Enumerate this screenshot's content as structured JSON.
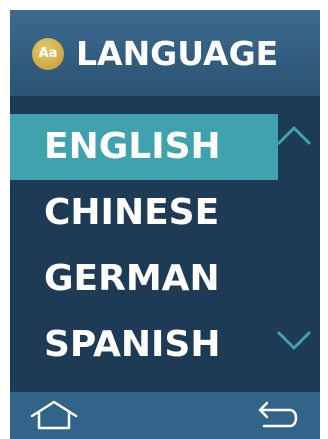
{
  "header": {
    "icon_text": "Aa",
    "title": "LANGUAGE"
  },
  "languages": [
    {
      "label": "ENGLISH",
      "selected": true
    },
    {
      "label": "CHINESE",
      "selected": false
    },
    {
      "label": "GERMAN",
      "selected": false
    },
    {
      "label": "SPANISH",
      "selected": false
    }
  ],
  "icons": {
    "scroll_up": "chevron-up-icon",
    "scroll_down": "chevron-down-icon",
    "home": "home-icon",
    "back": "back-arrow-icon"
  },
  "colors": {
    "background": "#1d3b54",
    "header": "#2b5373",
    "selection": "#3fa2ad",
    "footer": "#32648a",
    "icon_badge": "#d4b04a",
    "text": "#ffffff"
  }
}
